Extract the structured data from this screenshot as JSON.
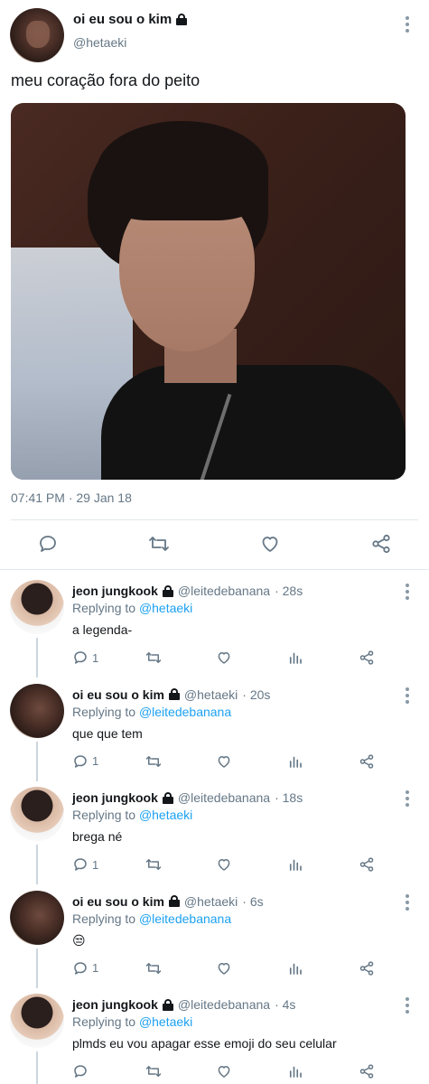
{
  "main_tweet": {
    "name": "oi eu sou o kim",
    "handle": "@hetaeki",
    "text": "meu coração fora do peito",
    "timestamp": "07:41 PM · 29 Jan 18",
    "icons": [
      "lock-icon",
      "more-icon",
      "reply-icon",
      "retweet-icon",
      "like-icon",
      "share-icon"
    ]
  },
  "replies": [
    {
      "name": "jeon jungkook",
      "handle": "@leitedebanana",
      "time": "· 28s",
      "replying_label": "Replying to",
      "replying_to": "@hetaeki",
      "text": "a legenda-",
      "reply_count": "1"
    },
    {
      "name": "oi eu sou o kim",
      "handle": "@hetaeki",
      "time": "· 20s",
      "replying_label": "Replying to",
      "replying_to": "@leitedebanana",
      "text": "que que tem",
      "reply_count": "1"
    },
    {
      "name": "jeon jungkook",
      "handle": "@leitedebanana",
      "time": "· 18s",
      "replying_label": "Replying to",
      "replying_to": "@hetaeki",
      "text": "brega né",
      "reply_count": "1"
    },
    {
      "name": "oi eu sou o kim",
      "handle": "@hetaeki",
      "time": "· 6s",
      "replying_label": "Replying to",
      "replying_to": "@leitedebanana",
      "text": "😒",
      "reply_count": "1"
    },
    {
      "name": "jeon jungkook",
      "handle": "@leitedebanana",
      "time": "· 4s",
      "replying_label": "Replying to",
      "replying_to": "@hetaeki",
      "text": "plmds eu vou apagar esse emoji do seu celular",
      "reply_count": ""
    }
  ],
  "colors": {
    "link": "#1da1f2",
    "muted": "#657786",
    "text": "#14171a",
    "divider": "#e1e8ed"
  }
}
